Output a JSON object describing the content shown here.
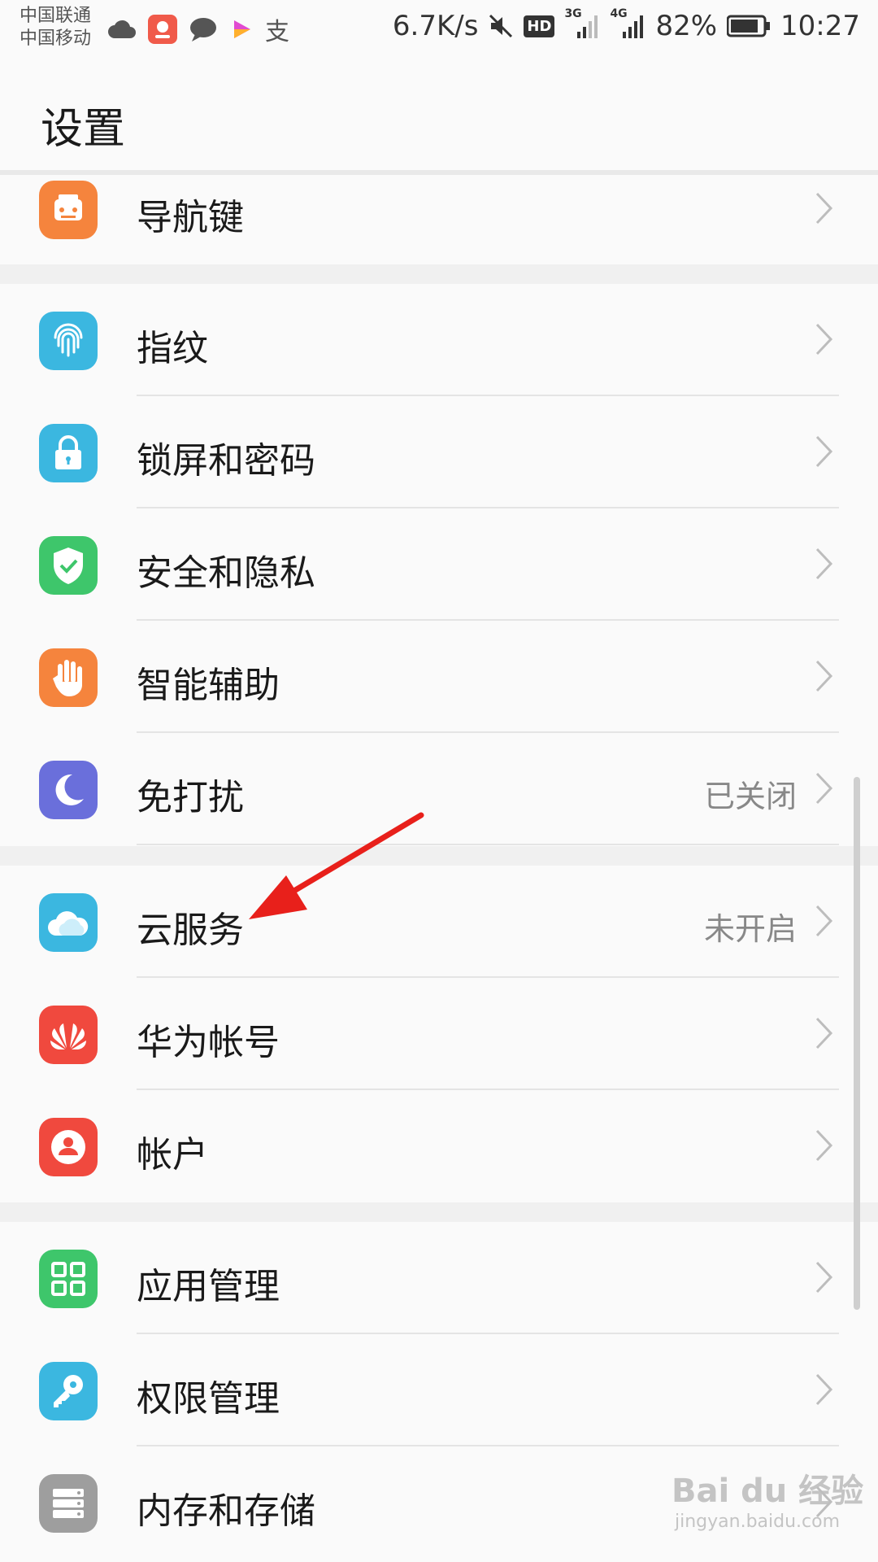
{
  "statusbar": {
    "carrier1": "中国联通",
    "carrier2": "中国移动",
    "netspeed": "6.7K/s",
    "hd": "HD",
    "net1": "3G",
    "net2": "4G",
    "battery": "82%",
    "time": "10:27",
    "notif_text_icon": "支"
  },
  "appbar": {
    "title": "设置"
  },
  "items": [
    {
      "label": "导航键",
      "value": "",
      "icon": "navigation-key-icon",
      "color": "#f5843d"
    },
    {
      "label": "指纹",
      "value": "",
      "icon": "fingerprint-icon",
      "color": "#3bb7e0"
    },
    {
      "label": "锁屏和密码",
      "value": "",
      "icon": "lock-icon",
      "color": "#3bb7e0"
    },
    {
      "label": "安全和隐私",
      "value": "",
      "icon": "shield-check-icon",
      "color": "#3ec66b"
    },
    {
      "label": "智能辅助",
      "value": "",
      "icon": "hand-icon",
      "color": "#f5843d"
    },
    {
      "label": "免打扰",
      "value": "已关闭",
      "icon": "moon-icon",
      "color": "#6a6fdb"
    },
    {
      "label": "云服务",
      "value": "未开启",
      "icon": "cloud-icon",
      "color": "#3bb7e0"
    },
    {
      "label": "华为帐号",
      "value": "",
      "icon": "huawei-logo-icon",
      "color": "#f0493e"
    },
    {
      "label": "帐户",
      "value": "",
      "icon": "account-icon",
      "color": "#f0493e"
    },
    {
      "label": "应用管理",
      "value": "",
      "icon": "app-grid-icon",
      "color": "#3ec66b"
    },
    {
      "label": "权限管理",
      "value": "",
      "icon": "key-icon",
      "color": "#3bb7e0"
    },
    {
      "label": "内存和存储",
      "value": "",
      "icon": "storage-icon",
      "color": "#9e9e9e"
    }
  ],
  "watermark": {
    "brand": "Bai du 经验",
    "url": "jingyan.baidu.com"
  }
}
